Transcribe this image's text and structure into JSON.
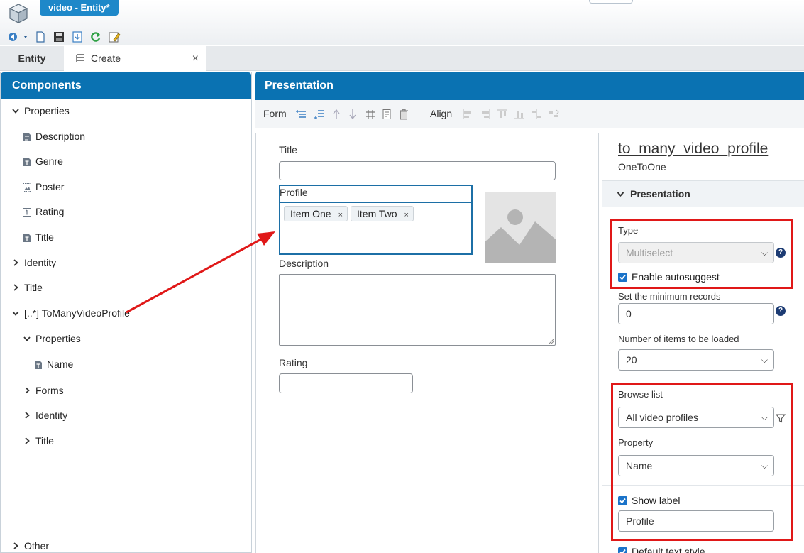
{
  "window": {
    "doc_tab": "video - Entity*"
  },
  "view_tabs": [
    {
      "label": "Entity"
    },
    {
      "label": "Create",
      "close": "×"
    }
  ],
  "components": {
    "title": "Components",
    "tree": [
      {
        "label": "Properties"
      },
      {
        "label": "Description"
      },
      {
        "label": "Genre"
      },
      {
        "label": "Poster"
      },
      {
        "label": "Rating"
      },
      {
        "label": "Title"
      },
      {
        "label": "Identity"
      },
      {
        "label": "Title"
      },
      {
        "label": "[..*] ToManyVideoProfile"
      },
      {
        "label": "Properties"
      },
      {
        "label": "Name"
      },
      {
        "label": "Forms"
      },
      {
        "label": "Identity"
      },
      {
        "label": "Title"
      },
      {
        "label": "Other"
      }
    ]
  },
  "presentation": {
    "title": "Presentation",
    "toolbar": {
      "form_label": "Form",
      "align_label": "Align"
    }
  },
  "form": {
    "title_label": "Title",
    "profile_label": "Profile",
    "chips": [
      {
        "label": "Item One",
        "x": "×"
      },
      {
        "label": "Item Two",
        "x": "×"
      }
    ],
    "description_label": "Description",
    "rating_label": "Rating"
  },
  "properties": {
    "name": "to_many_video_profile",
    "relation": "OneToOne",
    "section": "Presentation",
    "type_label": "Type",
    "type_value": "Multiselect",
    "autosuggest_label": "Enable autosuggest",
    "min_records_label": "Set the minimum records",
    "min_records_value": "0",
    "items_loaded_label": "Number of items to be loaded",
    "items_loaded_value": "20",
    "browse_list_label": "Browse list",
    "browse_list_value": "All video profiles",
    "property_label": "Property",
    "property_value": "Name",
    "show_label_label": "Show label",
    "label_value": "Profile",
    "default_text_style_label": "Default text style",
    "help": "?"
  },
  "colors": {
    "accent_blue": "#0a72b2",
    "highlight_red": "#e01818",
    "checkbox_blue": "#1a73c9"
  }
}
